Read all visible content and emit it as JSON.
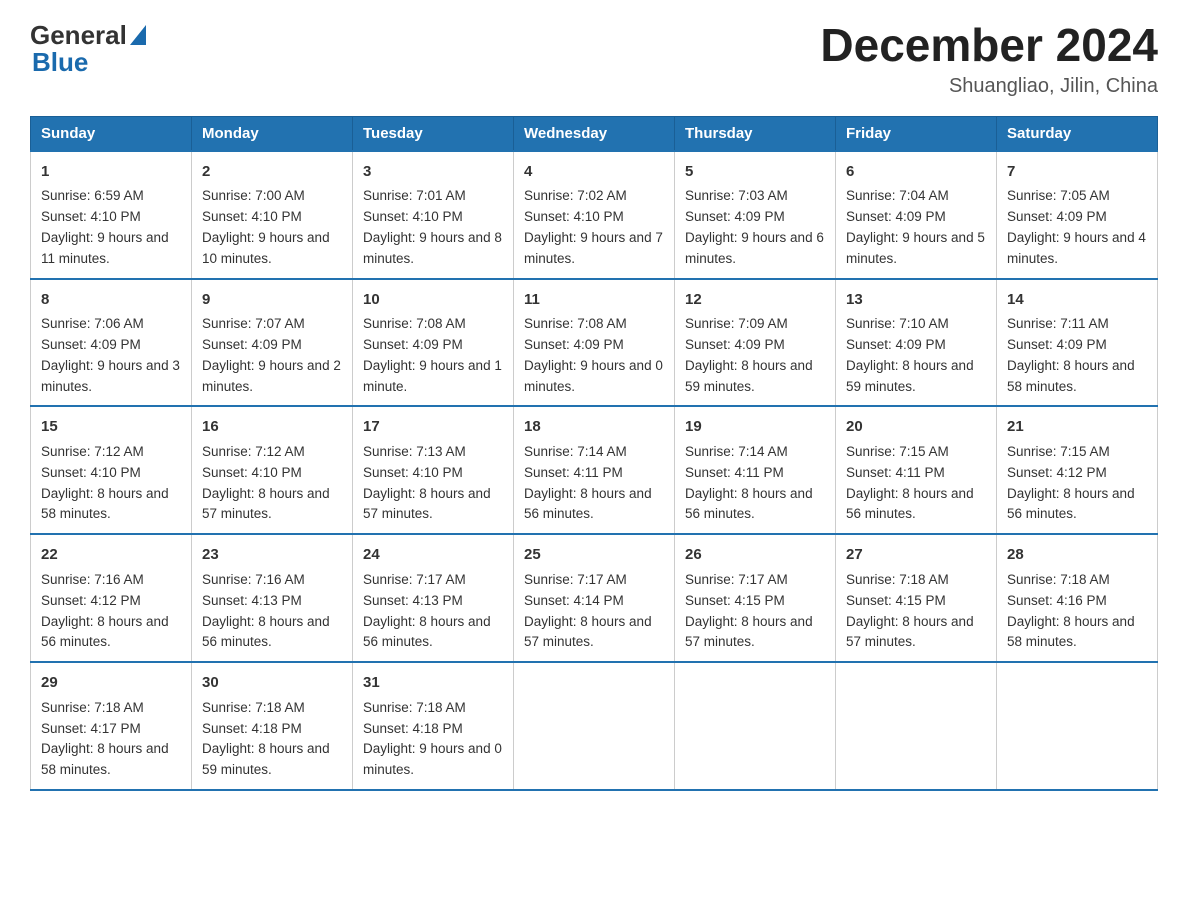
{
  "header": {
    "logo_general": "General",
    "logo_blue": "Blue",
    "title": "December 2024",
    "subtitle": "Shuangliao, Jilin, China"
  },
  "days_of_week": [
    "Sunday",
    "Monday",
    "Tuesday",
    "Wednesday",
    "Thursday",
    "Friday",
    "Saturday"
  ],
  "weeks": [
    [
      {
        "day": "1",
        "sunrise": "Sunrise: 6:59 AM",
        "sunset": "Sunset: 4:10 PM",
        "daylight": "Daylight: 9 hours and 11 minutes."
      },
      {
        "day": "2",
        "sunrise": "Sunrise: 7:00 AM",
        "sunset": "Sunset: 4:10 PM",
        "daylight": "Daylight: 9 hours and 10 minutes."
      },
      {
        "day": "3",
        "sunrise": "Sunrise: 7:01 AM",
        "sunset": "Sunset: 4:10 PM",
        "daylight": "Daylight: 9 hours and 8 minutes."
      },
      {
        "day": "4",
        "sunrise": "Sunrise: 7:02 AM",
        "sunset": "Sunset: 4:10 PM",
        "daylight": "Daylight: 9 hours and 7 minutes."
      },
      {
        "day": "5",
        "sunrise": "Sunrise: 7:03 AM",
        "sunset": "Sunset: 4:09 PM",
        "daylight": "Daylight: 9 hours and 6 minutes."
      },
      {
        "day": "6",
        "sunrise": "Sunrise: 7:04 AM",
        "sunset": "Sunset: 4:09 PM",
        "daylight": "Daylight: 9 hours and 5 minutes."
      },
      {
        "day": "7",
        "sunrise": "Sunrise: 7:05 AM",
        "sunset": "Sunset: 4:09 PM",
        "daylight": "Daylight: 9 hours and 4 minutes."
      }
    ],
    [
      {
        "day": "8",
        "sunrise": "Sunrise: 7:06 AM",
        "sunset": "Sunset: 4:09 PM",
        "daylight": "Daylight: 9 hours and 3 minutes."
      },
      {
        "day": "9",
        "sunrise": "Sunrise: 7:07 AM",
        "sunset": "Sunset: 4:09 PM",
        "daylight": "Daylight: 9 hours and 2 minutes."
      },
      {
        "day": "10",
        "sunrise": "Sunrise: 7:08 AM",
        "sunset": "Sunset: 4:09 PM",
        "daylight": "Daylight: 9 hours and 1 minute."
      },
      {
        "day": "11",
        "sunrise": "Sunrise: 7:08 AM",
        "sunset": "Sunset: 4:09 PM",
        "daylight": "Daylight: 9 hours and 0 minutes."
      },
      {
        "day": "12",
        "sunrise": "Sunrise: 7:09 AM",
        "sunset": "Sunset: 4:09 PM",
        "daylight": "Daylight: 8 hours and 59 minutes."
      },
      {
        "day": "13",
        "sunrise": "Sunrise: 7:10 AM",
        "sunset": "Sunset: 4:09 PM",
        "daylight": "Daylight: 8 hours and 59 minutes."
      },
      {
        "day": "14",
        "sunrise": "Sunrise: 7:11 AM",
        "sunset": "Sunset: 4:09 PM",
        "daylight": "Daylight: 8 hours and 58 minutes."
      }
    ],
    [
      {
        "day": "15",
        "sunrise": "Sunrise: 7:12 AM",
        "sunset": "Sunset: 4:10 PM",
        "daylight": "Daylight: 8 hours and 58 minutes."
      },
      {
        "day": "16",
        "sunrise": "Sunrise: 7:12 AM",
        "sunset": "Sunset: 4:10 PM",
        "daylight": "Daylight: 8 hours and 57 minutes."
      },
      {
        "day": "17",
        "sunrise": "Sunrise: 7:13 AM",
        "sunset": "Sunset: 4:10 PM",
        "daylight": "Daylight: 8 hours and 57 minutes."
      },
      {
        "day": "18",
        "sunrise": "Sunrise: 7:14 AM",
        "sunset": "Sunset: 4:11 PM",
        "daylight": "Daylight: 8 hours and 56 minutes."
      },
      {
        "day": "19",
        "sunrise": "Sunrise: 7:14 AM",
        "sunset": "Sunset: 4:11 PM",
        "daylight": "Daylight: 8 hours and 56 minutes."
      },
      {
        "day": "20",
        "sunrise": "Sunrise: 7:15 AM",
        "sunset": "Sunset: 4:11 PM",
        "daylight": "Daylight: 8 hours and 56 minutes."
      },
      {
        "day": "21",
        "sunrise": "Sunrise: 7:15 AM",
        "sunset": "Sunset: 4:12 PM",
        "daylight": "Daylight: 8 hours and 56 minutes."
      }
    ],
    [
      {
        "day": "22",
        "sunrise": "Sunrise: 7:16 AM",
        "sunset": "Sunset: 4:12 PM",
        "daylight": "Daylight: 8 hours and 56 minutes."
      },
      {
        "day": "23",
        "sunrise": "Sunrise: 7:16 AM",
        "sunset": "Sunset: 4:13 PM",
        "daylight": "Daylight: 8 hours and 56 minutes."
      },
      {
        "day": "24",
        "sunrise": "Sunrise: 7:17 AM",
        "sunset": "Sunset: 4:13 PM",
        "daylight": "Daylight: 8 hours and 56 minutes."
      },
      {
        "day": "25",
        "sunrise": "Sunrise: 7:17 AM",
        "sunset": "Sunset: 4:14 PM",
        "daylight": "Daylight: 8 hours and 57 minutes."
      },
      {
        "day": "26",
        "sunrise": "Sunrise: 7:17 AM",
        "sunset": "Sunset: 4:15 PM",
        "daylight": "Daylight: 8 hours and 57 minutes."
      },
      {
        "day": "27",
        "sunrise": "Sunrise: 7:18 AM",
        "sunset": "Sunset: 4:15 PM",
        "daylight": "Daylight: 8 hours and 57 minutes."
      },
      {
        "day": "28",
        "sunrise": "Sunrise: 7:18 AM",
        "sunset": "Sunset: 4:16 PM",
        "daylight": "Daylight: 8 hours and 58 minutes."
      }
    ],
    [
      {
        "day": "29",
        "sunrise": "Sunrise: 7:18 AM",
        "sunset": "Sunset: 4:17 PM",
        "daylight": "Daylight: 8 hours and 58 minutes."
      },
      {
        "day": "30",
        "sunrise": "Sunrise: 7:18 AM",
        "sunset": "Sunset: 4:18 PM",
        "daylight": "Daylight: 8 hours and 59 minutes."
      },
      {
        "day": "31",
        "sunrise": "Sunrise: 7:18 AM",
        "sunset": "Sunset: 4:18 PM",
        "daylight": "Daylight: 9 hours and 0 minutes."
      },
      null,
      null,
      null,
      null
    ]
  ]
}
